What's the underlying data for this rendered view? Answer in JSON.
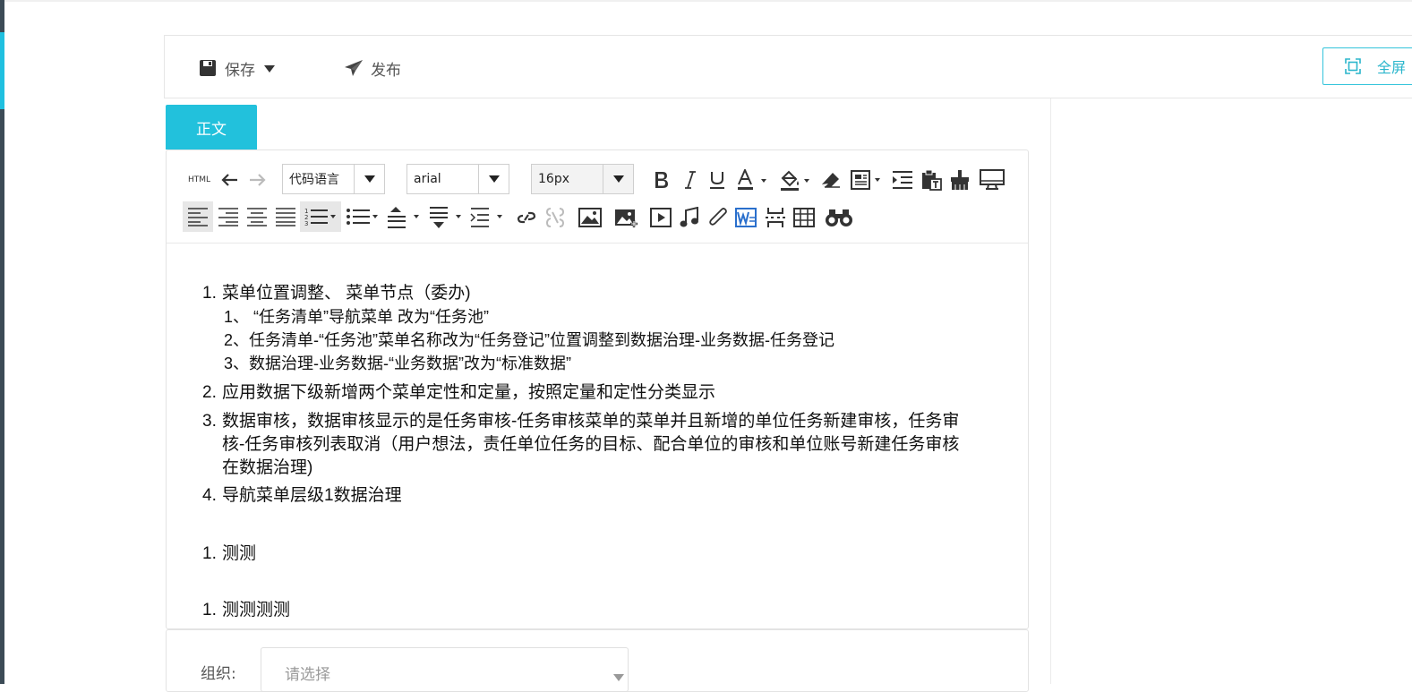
{
  "toolbar": {
    "save_label": "保存",
    "publish_label": "发布",
    "fullscreen_label": "全屏"
  },
  "tabs": [
    {
      "label": "正文"
    }
  ],
  "editor_toolbar": {
    "html_label": "HTML",
    "code_language": "代码语言",
    "font_family": "arial",
    "font_size": "16px"
  },
  "content": {
    "list1": [
      {
        "num": "1.",
        "text": "菜单位置调整、 菜单节点（委办)"
      },
      {
        "num": "2.",
        "text": "应用数据下级新增两个菜单定性和定量，按照定量和定性分类显示"
      },
      {
        "num": "3.",
        "text_lines": [
          "数据审核，数据审核显示的是任务审核-任务审核菜单的菜单并且新增的单位任务新建审核，任务审",
          "核-任务审核列表取消（用户想法，责任单位任务的目标、配合单位的审核和单位账号新建任务审核",
          "在数据治理)"
        ]
      },
      {
        "num": "4.",
        "text": "导航菜单层级1数据治理"
      }
    ],
    "sub_items": [
      "1、 “任务清单”导航菜单 改为“任务池”",
      "2、任务清单-“任务池”菜单名称改为“任务登记”位置调整到数据治理-业务数据-任务登记",
      "3、数据治理-业务数据-“业务数据”改为“标准数据”"
    ],
    "list2": [
      {
        "num": "1.",
        "text": "测测"
      }
    ],
    "list3": [
      {
        "num": "1.",
        "text": "测测测测"
      }
    ]
  },
  "form": {
    "org_label": "组织:",
    "org_placeholder": "请选择"
  },
  "colors": {
    "accent": "#22c1dc",
    "sidebar": "#3c4b56"
  }
}
